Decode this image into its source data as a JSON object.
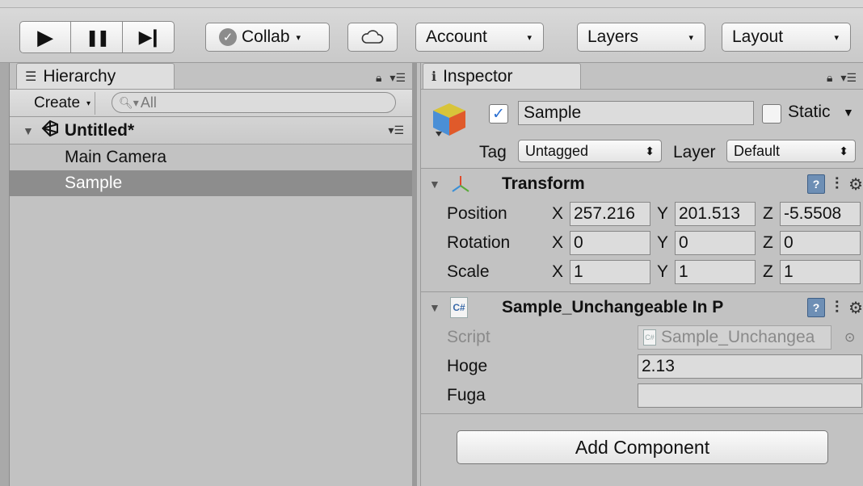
{
  "toolbar": {
    "collab_label": "Collab",
    "account_label": "Account",
    "layers_label": "Layers",
    "layout_label": "Layout",
    "caret": "▾",
    "play_icon": "▶",
    "pause_icon": "❚❚",
    "step_icon": "▶❙"
  },
  "hierarchy": {
    "tab_label": "Hierarchy",
    "create_label": "Create",
    "search_placeholder": "All",
    "scene_name": "Untitled*",
    "items": [
      {
        "label": "Main Camera",
        "selected": false
      },
      {
        "label": "Sample",
        "selected": true
      }
    ]
  },
  "inspector": {
    "tab_label": "Inspector",
    "object_name": "Sample",
    "active": true,
    "static_label": "Static",
    "tag_label": "Tag",
    "tag_value": "Untagged",
    "layer_label": "Layer",
    "layer_value": "Default",
    "transform": {
      "title": "Transform",
      "position_label": "Position",
      "rotation_label": "Rotation",
      "scale_label": "Scale",
      "axis_x": "X",
      "axis_y": "Y",
      "axis_z": "Z",
      "position": {
        "x": "257.216",
        "y": "201.513",
        "z": "-5.5508"
      },
      "rotation": {
        "x": "0",
        "y": "0",
        "z": "0"
      },
      "scale": {
        "x": "1",
        "y": "1",
        "z": "1"
      }
    },
    "script_component": {
      "title": "Sample_Unchangeable In P",
      "cs_badge": "C#",
      "script_label": "Script",
      "script_value": "Sample_Unchangea",
      "hoge_label": "Hoge",
      "hoge_value": "2.13",
      "fuga_label": "Fuga",
      "fuga_value": ""
    },
    "add_component_label": "Add Component"
  }
}
